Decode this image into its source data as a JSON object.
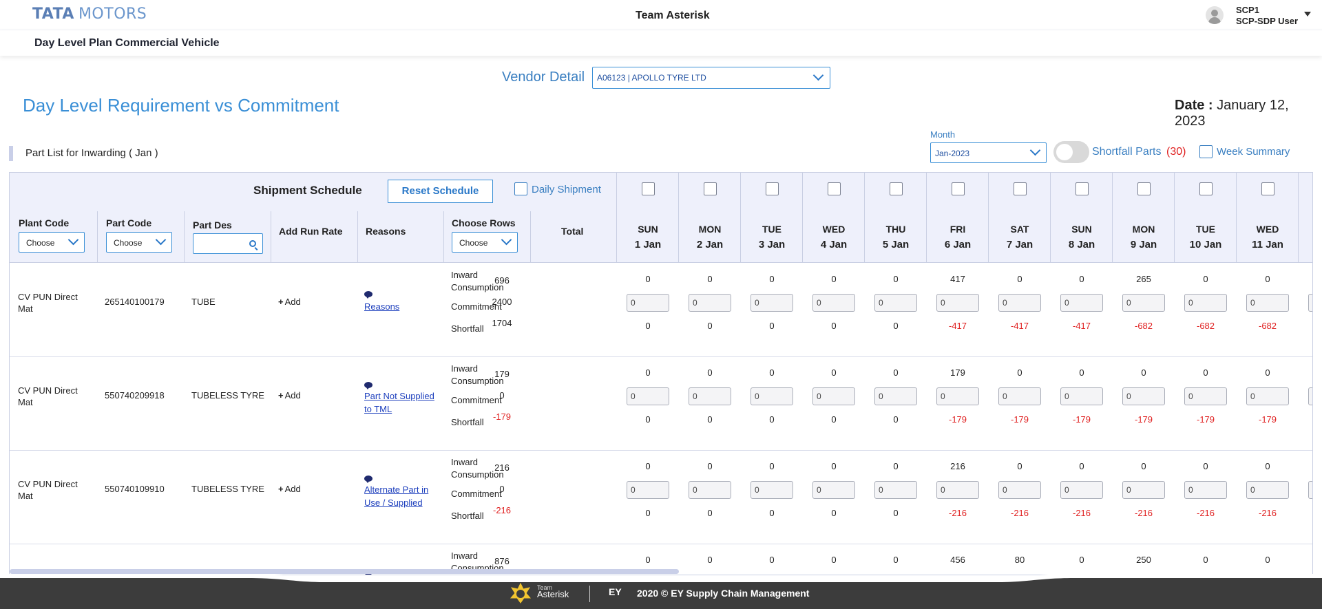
{
  "header": {
    "logo_tata": "TATA",
    "logo_motors": "MOTORS",
    "team_title": "Team Asterisk",
    "user_line1": "SCP1",
    "user_line2": "SCP-SDP User",
    "page_subtitle": "Day Level Plan Commercial Vehicle"
  },
  "vendor": {
    "label": "Vendor Detail",
    "selected": "A06123 | APOLLO TYRE LTD"
  },
  "main": {
    "title": "Day Level Requirement vs Commitment",
    "date_label": "Date :",
    "date_value": "January 12, 2023",
    "part_list_label": "Part List for Inwarding ( Jan )",
    "month_label": "Month",
    "month_value": "Jan-2023",
    "shortfall_label": "Shortfall Parts",
    "shortfall_count": "(30)",
    "shortfall_toggle_on": false,
    "week_summary_label": "Week Summary"
  },
  "table": {
    "shipment_title": "Shipment Schedule",
    "reset_label": "Reset Schedule",
    "daily_shipment_label": "Daily Shipment",
    "headers": {
      "plant_code": "Plant Code",
      "part_code": "Part Code",
      "part_des": "Part Des",
      "add_run_rate": "Add Run Rate",
      "reasons": "Reasons",
      "choose_rows": "Choose Rows",
      "total": "Total"
    },
    "filters": {
      "plant_code": "Choose",
      "part_code": "Choose",
      "choose_rows": "Choose"
    },
    "days": [
      {
        "day": "SUN",
        "date": "1 Jan"
      },
      {
        "day": "MON",
        "date": "2 Jan"
      },
      {
        "day": "TUE",
        "date": "3 Jan"
      },
      {
        "day": "WED",
        "date": "4 Jan"
      },
      {
        "day": "THU",
        "date": "5 Jan"
      },
      {
        "day": "FRI",
        "date": "6 Jan"
      },
      {
        "day": "SAT",
        "date": "7 Jan"
      },
      {
        "day": "SUN",
        "date": "8 Jan"
      },
      {
        "day": "MON",
        "date": "9 Jan"
      },
      {
        "day": "TUE",
        "date": "10 Jan"
      },
      {
        "day": "WED",
        "date": "11 Jan"
      }
    ],
    "row_labels": {
      "inward_1": "Inward",
      "inward_2": "Consumption",
      "commitment": "Commitment",
      "shortfall": "Shortfall"
    },
    "add_label": "Add",
    "rows": [
      {
        "plant_1": "CV PUN Direct",
        "plant_2": "Mat",
        "part_code": "265140100179",
        "part_des": "TUBE",
        "reason_1": "Reasons",
        "reason_2": "",
        "total_inward": "696",
        "total_commit": "2400",
        "total_short": "1704",
        "inward": [
          "0",
          "0",
          "0",
          "0",
          "0",
          "417",
          "0",
          "0",
          "265",
          "0",
          "0"
        ],
        "commit": [
          "0",
          "0",
          "0",
          "0",
          "0",
          "0",
          "0",
          "0",
          "0",
          "0",
          "0"
        ],
        "short": [
          "0",
          "0",
          "0",
          "0",
          "0",
          "-417",
          "-417",
          "-417",
          "-682",
          "-682",
          "-682"
        ]
      },
      {
        "plant_1": "CV PUN Direct",
        "plant_2": "Mat",
        "part_code": "550740209918",
        "part_des": "TUBELESS TYRE",
        "reason_1": "Part Not Supplied",
        "reason_2": "to TML",
        "total_inward": "179",
        "total_commit": "0",
        "total_short": "-179",
        "inward": [
          "0",
          "0",
          "0",
          "0",
          "0",
          "179",
          "0",
          "0",
          "0",
          "0",
          "0"
        ],
        "commit": [
          "0",
          "0",
          "0",
          "0",
          "0",
          "0",
          "0",
          "0",
          "0",
          "0",
          "0"
        ],
        "short": [
          "0",
          "0",
          "0",
          "0",
          "0",
          "-179",
          "-179",
          "-179",
          "-179",
          "-179",
          "-179"
        ]
      },
      {
        "plant_1": "CV PUN Direct",
        "plant_2": "Mat",
        "part_code": "550740109910",
        "part_des": "TUBELESS TYRE",
        "reason_1": "Alternate Part in",
        "reason_2": "Use / Supplied",
        "total_inward": "216",
        "total_commit": "0",
        "total_short": "-216",
        "inward": [
          "0",
          "0",
          "0",
          "0",
          "0",
          "216",
          "0",
          "0",
          "0",
          "0",
          "0"
        ],
        "commit": [
          "0",
          "0",
          "0",
          "0",
          "0",
          "0",
          "0",
          "0",
          "0",
          "0",
          "0"
        ],
        "short": [
          "0",
          "0",
          "0",
          "0",
          "0",
          "-216",
          "-216",
          "-216",
          "-216",
          "-216",
          "-216"
        ]
      },
      {
        "plant_1": "",
        "plant_2": "",
        "part_code": "",
        "part_des": "",
        "reason_1": "",
        "reason_2": "",
        "total_inward": "876",
        "total_commit": "",
        "total_short": "",
        "inward": [
          "0",
          "0",
          "0",
          "0",
          "0",
          "456",
          "80",
          "0",
          "250",
          "0",
          "0"
        ],
        "commit": [],
        "short": []
      }
    ]
  },
  "footer": {
    "team_small": "Team",
    "team_big": "Asterisk",
    "ey": "EY",
    "copyright": "2020 © EY Supply Chain Management"
  }
}
